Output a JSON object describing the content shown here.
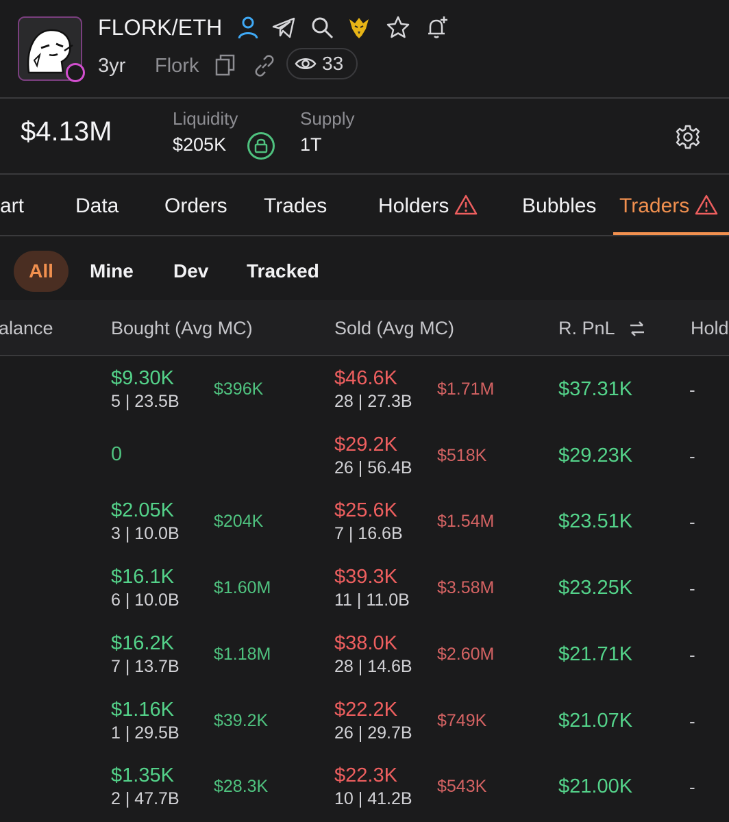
{
  "header": {
    "pair": "FLORK/ETH",
    "age": "3yr",
    "token_name": "Flork",
    "views": "33",
    "icons": [
      "user-icon",
      "telegram-icon",
      "search-icon",
      "eagle-icon",
      "star-icon",
      "bell-plus-icon",
      "copy-icon",
      "link-icon",
      "eye-icon"
    ]
  },
  "stats": {
    "market_cap": "$4.13M",
    "liquidity_label": "Liquidity",
    "liquidity_value": "$205K",
    "supply_label": "Supply",
    "supply_value": "1T"
  },
  "tabs": [
    "art",
    "Data",
    "Orders",
    "Trades",
    "Holders",
    "Bubbles",
    "Traders"
  ],
  "active_tab": "Traders",
  "filters": [
    "All",
    "Mine",
    "Dev",
    "Tracked"
  ],
  "active_filter": "All",
  "columns": [
    "alance",
    "Bought (Avg MC)",
    "Sold (Avg MC)",
    "R. PnL",
    "Hold"
  ],
  "rows": [
    {
      "bought": "$9.30K",
      "bought_sub": "5 | 23.5B",
      "bought_mc": "$396K",
      "sold": "$46.6K",
      "sold_sub": "28 | 27.3B",
      "sold_mc": "$1.71M",
      "pnl": "$37.31K",
      "hold": "-"
    },
    {
      "bought": "0",
      "bought_sub": "",
      "bought_mc": "",
      "sold": "$29.2K",
      "sold_sub": "26 | 56.4B",
      "sold_mc": "$518K",
      "pnl": "$29.23K",
      "hold": "-"
    },
    {
      "bought": "$2.05K",
      "bought_sub": "3 | 10.0B",
      "bought_mc": "$204K",
      "sold": "$25.6K",
      "sold_sub": "7 | 16.6B",
      "sold_mc": "$1.54M",
      "pnl": "$23.51K",
      "hold": "-"
    },
    {
      "bought": "$16.1K",
      "bought_sub": "6 | 10.0B",
      "bought_mc": "$1.60M",
      "sold": "$39.3K",
      "sold_sub": "11 | 11.0B",
      "sold_mc": "$3.58M",
      "pnl": "$23.25K",
      "hold": "-"
    },
    {
      "bought": "$16.2K",
      "bought_sub": "7 | 13.7B",
      "bought_mc": "$1.18M",
      "sold": "$38.0K",
      "sold_sub": "28 | 14.6B",
      "sold_mc": "$2.60M",
      "pnl": "$21.71K",
      "hold": "-"
    },
    {
      "bought": "$1.16K",
      "bought_sub": "1 | 29.5B",
      "bought_mc": "$39.2K",
      "sold": "$22.2K",
      "sold_sub": "26 | 29.7B",
      "sold_mc": "$749K",
      "pnl": "$21.07K",
      "hold": "-"
    },
    {
      "bought": "$1.35K",
      "bought_sub": "2 | 47.7B",
      "bought_mc": "$28.3K",
      "sold": "$22.3K",
      "sold_sub": "10 | 41.2B",
      "sold_mc": "$543K",
      "pnl": "$21.00K",
      "hold": "-"
    }
  ],
  "colors": {
    "background": "#1b1b1c",
    "accent": "#f1904f",
    "buy_green": "#4fc27f",
    "sell_red": "#ee5f5f",
    "muted": "#8e8e93"
  }
}
